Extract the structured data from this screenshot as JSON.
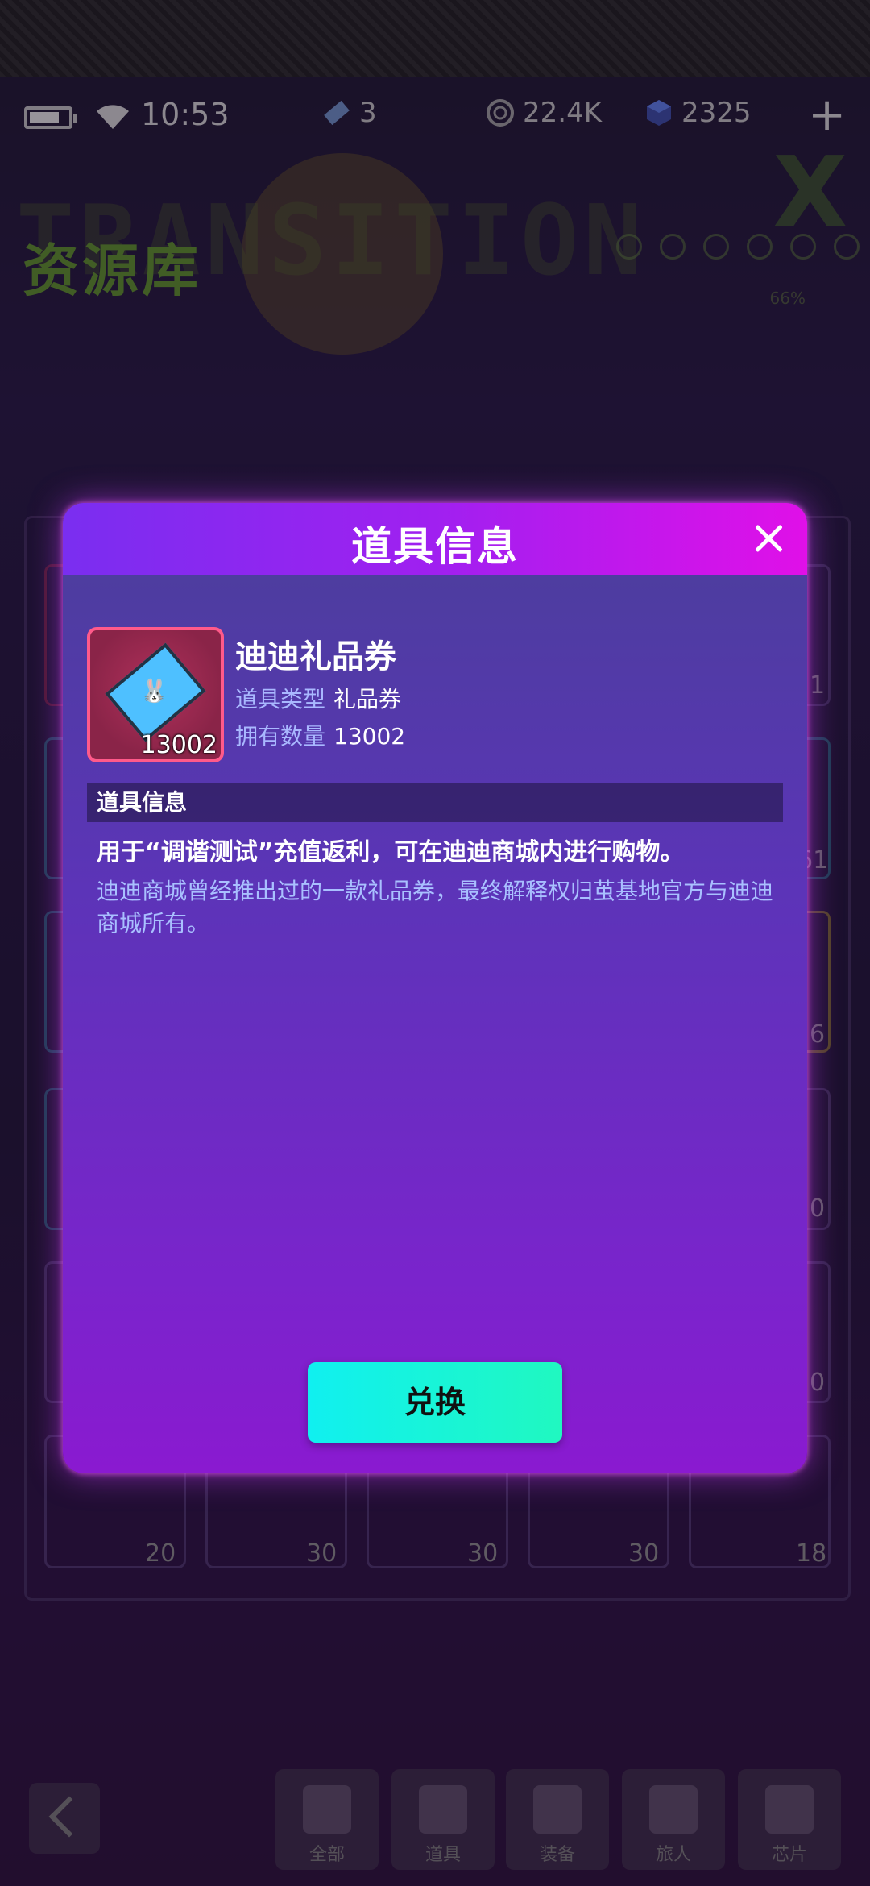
{
  "status_bar": {
    "time": "10:53",
    "tickets": "3",
    "coins": "22.4K",
    "gems": "2325"
  },
  "header": {
    "title": "资源库",
    "progress_text": "66%"
  },
  "background_counts": [
    "1",
    "61",
    "6",
    "0",
    "0",
    "20",
    "30",
    "30",
    "30",
    "18"
  ],
  "bottom_nav": {
    "items": [
      {
        "label": "全部"
      },
      {
        "label": "道具"
      },
      {
        "label": "装备"
      },
      {
        "label": "旅人"
      },
      {
        "label": "芯片"
      }
    ]
  },
  "modal": {
    "title": "道具信息",
    "item": {
      "name": "迪迪礼品券",
      "count_badge": "13002",
      "type_label": "道具类型",
      "type_value": "礼品券",
      "owned_label": "拥有数量",
      "owned_value": "13002"
    },
    "section_title": "道具信息",
    "description_main": "用于“调谐测试”充值返利，可在迪迪商城内进行购物。",
    "description_flavor": "迪迪商城曾经推出过的一款礼品券，最终解释权归茧基地官方与迪迪商城所有。",
    "exchange_label": "兑换"
  },
  "colors": {
    "accent_cyan": "#10f0f0",
    "modal_header_magenta": "#e010e8",
    "item_border": "#ff5a8a"
  }
}
